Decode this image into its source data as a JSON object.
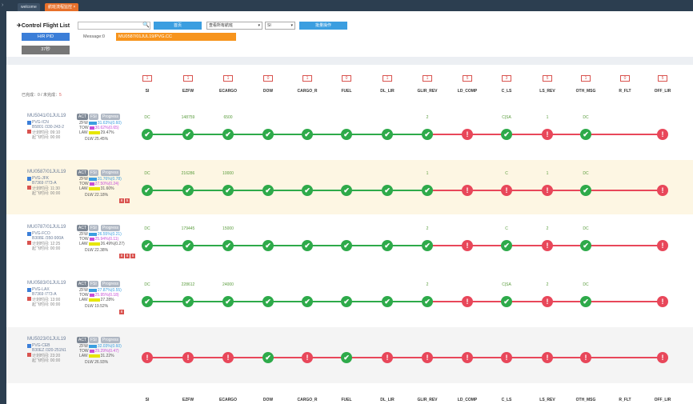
{
  "window": {
    "tabs": [
      {
        "label": "welcome"
      },
      {
        "label": "航班流程监控 ×"
      }
    ]
  },
  "toolbar": {
    "title": "✈Control Flight List",
    "search_value": "",
    "home_label": "首页",
    "view_select": "查看所有航班",
    "stage_select": "SI",
    "batch_label": "批量操作"
  },
  "header": {
    "hrpid_label": "H/R PID",
    "message_label": "Message:0",
    "message_value": "MU0587/01JUL19/PVG.CC",
    "timer_label": "37秒"
  },
  "counts": {
    "done_label": "已完成：0 / 未完成：",
    "undone": "5"
  },
  "columns": [
    {
      "label": "SI",
      "count": "1"
    },
    {
      "label": "EZFW",
      "count": "1"
    },
    {
      "label": "ECARGO",
      "count": "1"
    },
    {
      "label": "DOW",
      "count": "0"
    },
    {
      "label": "CARGO_R",
      "count": "1"
    },
    {
      "label": "FUEL",
      "count": "0"
    },
    {
      "label": "DL_LIR",
      "count": "1"
    },
    {
      "label": "GLIR_REV",
      "count": "1"
    },
    {
      "label": "LD_COMP",
      "count": "5"
    },
    {
      "label": "C_LS",
      "count": "3"
    },
    {
      "label": "LS_REV",
      "count": "5"
    },
    {
      "label": "OTH_MSG",
      "count": "1"
    },
    {
      "label": "R_FLT",
      "count": "0"
    },
    {
      "label": "OFF_LIR",
      "count": "5"
    }
  ],
  "flights": [
    {
      "id": "MU5041/01JUL19",
      "act": "ACT",
      "fsi": "FSI",
      "prog": "Progress",
      "route": "PVG-ICN",
      "ac": "B5801 /330-243-2",
      "sched": "计划时间: 09:10",
      "actual": "起飞时间: 00:00",
      "zfw": "ZFW",
      "zfwv": "31.63%(0.60)",
      "tow": "TOW",
      "towv": "30.62%(0.65)",
      "law": "LAW",
      "lawv": "29.47%",
      "dlw": "DLW 25.45%",
      "vals": [
        "DC",
        "148759",
        "6500",
        "",
        "",
        "",
        "",
        "2",
        "",
        "C|SA",
        "1",
        "DC",
        "",
        ""
      ],
      "status": [
        "ok",
        "ok",
        "ok",
        "ok",
        "ok",
        "ok",
        "ok",
        "ok",
        "bad",
        "ok",
        "bad",
        "ok",
        "none",
        "bad"
      ],
      "bg": "#ffffff",
      "red_tags": []
    },
    {
      "id": "MU0587/01JUL19",
      "act": "ACT",
      "fsi": "FSI",
      "prog": "Progress",
      "route": "PVG-JFK",
      "ac": "B7369 /773-A",
      "sched": "计划时间: 11:30",
      "actual": "起飞时间: 00:00",
      "zfw": "ZFW",
      "zfwv": "31.76%(0.78)",
      "tow": "TOW",
      "towv": "27.50%(0.24)",
      "law": "LAW",
      "lawv": "31.60%",
      "dlw": "DLW 22.18%",
      "vals": [
        "DC",
        "216286",
        "10000",
        "",
        "",
        "",
        "",
        "1",
        "",
        "C",
        "1",
        "DC",
        "",
        ""
      ],
      "status": [
        "ok",
        "ok",
        "ok",
        "ok",
        "ok",
        "ok",
        "ok",
        "ok",
        "bad",
        "bad",
        "bad",
        "ok",
        "none",
        "bad"
      ],
      "bg": "#fdf6e3",
      "red_tags": [
        "8",
        "5"
      ]
    },
    {
      "id": "MU0787/01JUL19",
      "act": "ACT",
      "fsi": "FSI",
      "prog": "Progress",
      "route": "PVG-FCO",
      "ac": "B308E /350-900A",
      "sched": "计划时间: 12:25",
      "actual": "起飞时间: 00:00",
      "zfw": "ZFW",
      "zfwv": "26.55%(0.21)",
      "tow": "TOW",
      "towv": "25.94%(0.11)",
      "law": "LAW",
      "lawv": "26.49%(0.27)",
      "dlw": "DLW 22.38%",
      "vals": [
        "DC",
        "179445",
        "15000",
        "",
        "",
        "",
        "",
        "2",
        "",
        "C",
        "2",
        "DC",
        "",
        ""
      ],
      "status": [
        "ok",
        "ok",
        "ok",
        "ok",
        "ok",
        "ok",
        "ok",
        "ok",
        "bad",
        "ok",
        "bad",
        "ok",
        "none",
        "bad"
      ],
      "bg": "#ffffff",
      "red_tags": [
        "8",
        "8",
        "5"
      ]
    },
    {
      "id": "MU0583/01JUL19",
      "act": "ACT",
      "fsi": "FSI",
      "prog": "Progress",
      "route": "PVG-LAX",
      "ac": "B7369 /773-A",
      "sched": "计划时间: 13:00",
      "actual": "起飞时间: 00:00",
      "zfw": "ZFW",
      "zfwv": "27.87%(0.55)",
      "tow": "TOW",
      "towv": "25.95%(0.18)",
      "law": "LAW",
      "lawv": "27.28%",
      "dlw": "DLW 19.52%",
      "vals": [
        "DC",
        "228612",
        "24000",
        "",
        "",
        "",
        "",
        "2",
        "",
        "C|SA",
        "2",
        "DC",
        "",
        ""
      ],
      "status": [
        "ok",
        "ok",
        "ok",
        "ok",
        "ok",
        "ok",
        "ok",
        "ok",
        "bad",
        "ok",
        "bad",
        "ok",
        "none",
        "bad"
      ],
      "bg": "#ffffff",
      "red_tags": [
        "8"
      ]
    },
    {
      "id": "MU5023/01JUL19",
      "act": "ACT",
      "fsi": "FSI",
      "prog": "Progress",
      "route": "PVG-CEB",
      "ac": "B30EZ /320-251N1",
      "sched": "计划时间: 23:20",
      "actual": "起飞时间: 00:00",
      "zfw": "ZFW",
      "zfwv": "32.03%(0.60)",
      "tow": "TOW",
      "towv": "29.29%(0.47)",
      "law": "LAW",
      "lawv": "31.22%",
      "dlw": "DLW 26.93%",
      "vals": [
        "",
        "",
        "",
        "",
        "",
        "",
        "",
        "",
        "",
        "",
        "",
        "",
        "",
        ""
      ],
      "status": [
        "bad",
        "bad",
        "bad",
        "ok",
        "bad",
        "ok",
        "bad",
        "bad",
        "bad",
        "bad",
        "bad",
        "bad",
        "none",
        "bad"
      ],
      "bg": "#f4f4f4",
      "red_tags": []
    }
  ]
}
